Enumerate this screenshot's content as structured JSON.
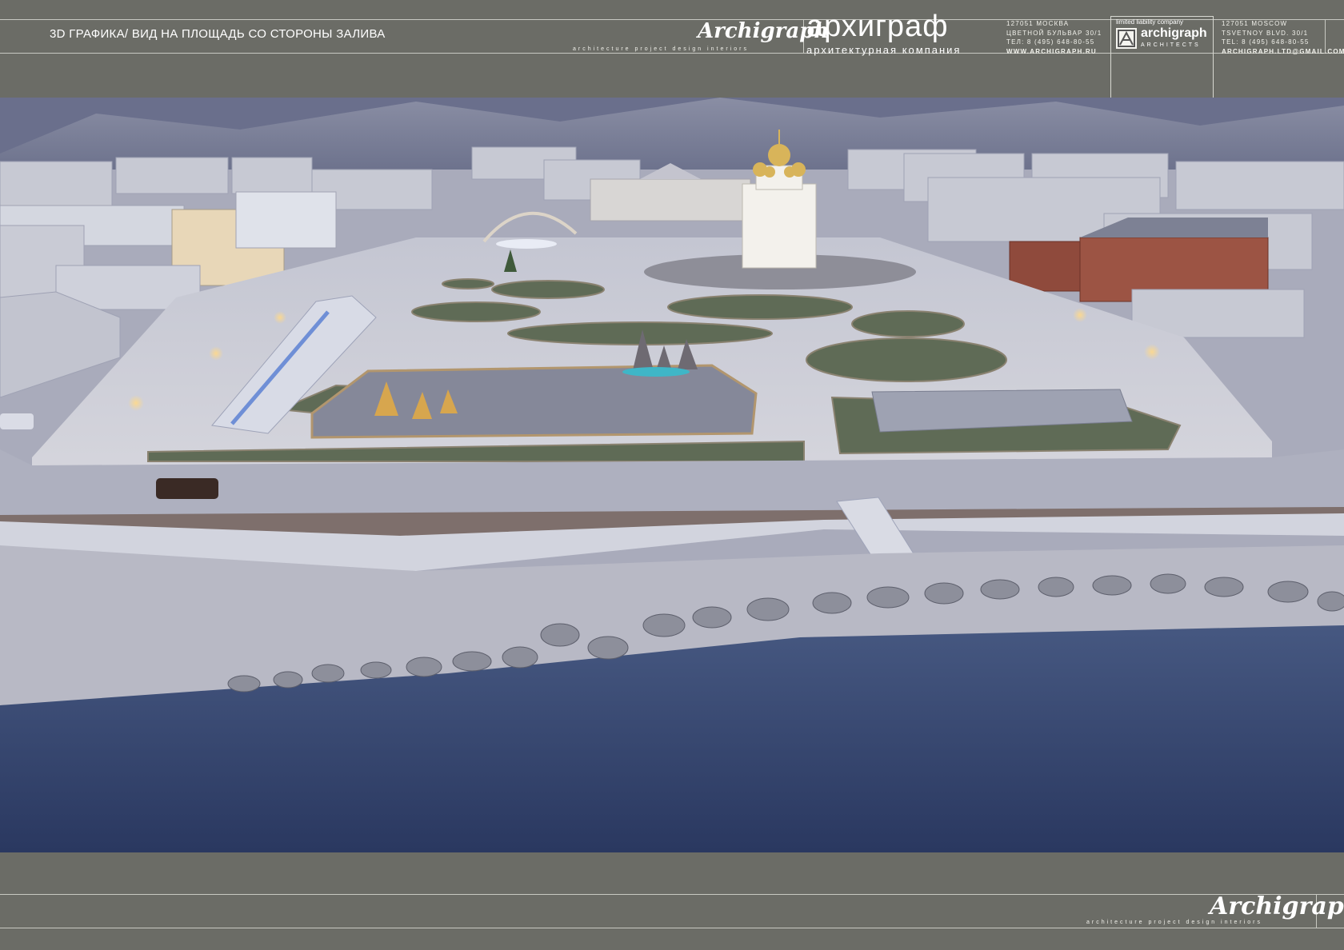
{
  "header": {
    "title": "3D ГРАФИКА/ ВИД НА ПЛОЩАДЬ СО СТОРОНЫ ЗАЛИВА",
    "signature": "Archigraph",
    "tagline": "architecture project design interiors",
    "brand_ru": "архиграф",
    "brand_subtitle": "архитектурная компания",
    "address_ru": [
      "127051 МОСКВА",
      "ЦВЕТНОЙ БУЛЬВАР 30/1",
      "ТЕЛ: 8 (495) 648-80-55",
      "WWW.ARCHIGRAPH.RU"
    ],
    "logo_llc": "limited liability company",
    "logo_name": "archigraph",
    "logo_sub": "ARCHITECTS",
    "address_en": [
      "127051 MOSCOW",
      "TSVETNOY BLVD. 30/1",
      "TEL: 8 (495) 648-80-55",
      "ARCHIGRAPH.LTD@GMAIL.COM"
    ]
  },
  "footer": {
    "signature": "Archigraph",
    "tagline": "architecture project design interiors"
  },
  "colors": {
    "frame": "#6b6c66",
    "sky_mountains": "#5a607a",
    "water": "#2f3e66",
    "plaza": "#c9c9d3",
    "snow": "#b9bac6"
  }
}
